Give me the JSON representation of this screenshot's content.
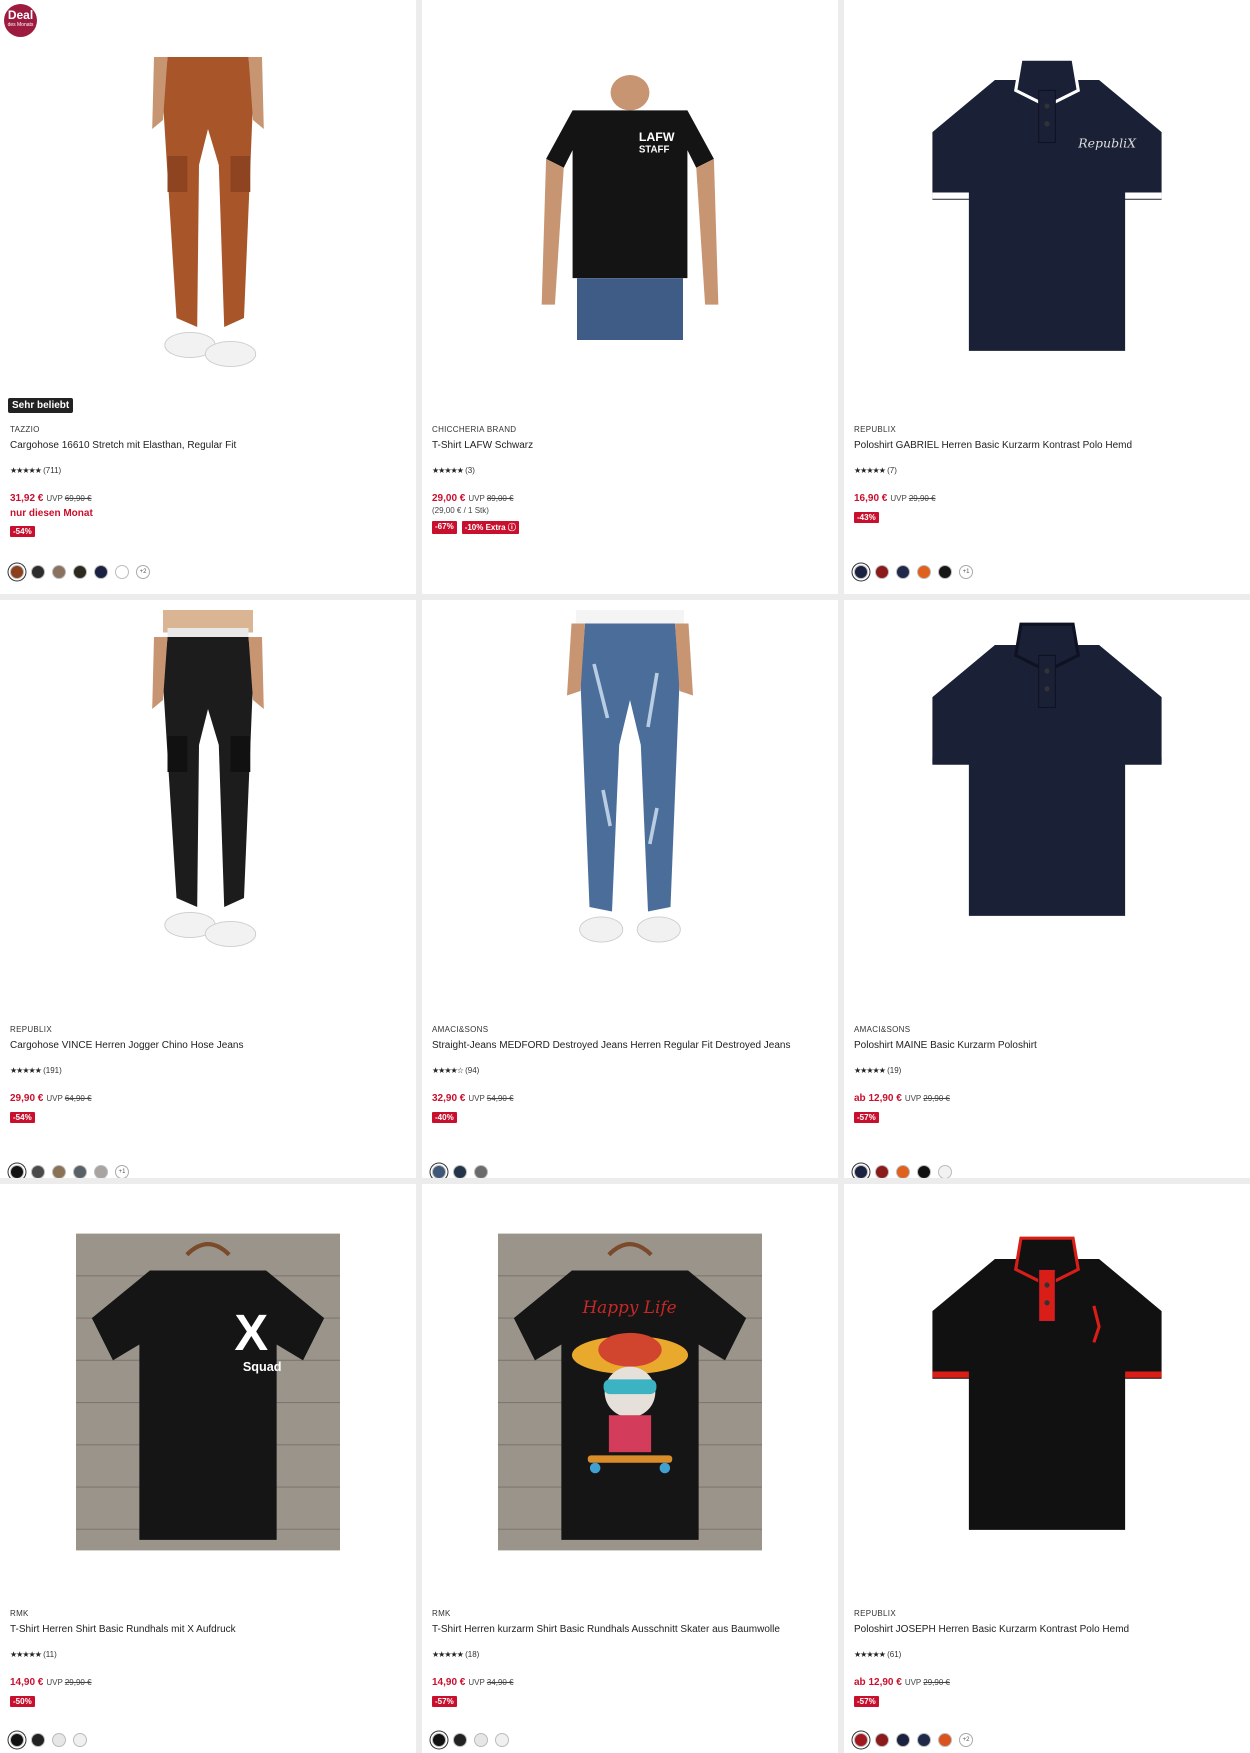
{
  "deal_badge": {
    "label": "Deal",
    "sub": "des Monats"
  },
  "products": [
    {
      "brand": "TAZZIO",
      "title": "Cargohose 16610 Stretch mit Elasthan, Regular Fit",
      "stars": "★★★★★",
      "reviews": "(711)",
      "price": "31,92 €",
      "uvp": "UVP",
      "old_price": "69,90 €",
      "month": "nur diesen Monat",
      "unit": "",
      "discounts": [
        "-54%"
      ],
      "swatches": [
        "#8b3f1c",
        "#2d2d2d",
        "#8a7260",
        "#2c2a1e",
        "#1b2140",
        "#ffffff"
      ],
      "more": "+2",
      "popular": "Sehr beliebt",
      "image": "pants-brown"
    },
    {
      "brand": "CHICCHERIA BRAND",
      "title": "T-Shirt LAFW Schwarz",
      "stars": "★★★★★",
      "reviews": "(3)",
      "price": "29,00 €",
      "uvp": "UVP",
      "old_price": "89,00 €",
      "month": "",
      "unit": "(29,00 € / 1 Stk)",
      "discounts": [
        "-67%",
        "-10% Extra ⓘ"
      ],
      "swatches": [],
      "more": "",
      "popular": "",
      "image": "tshirt-lafw"
    },
    {
      "brand": "REPUBLIX",
      "title": "Poloshirt GABRIEL Herren Basic Kurzarm Kontrast Polo Hemd",
      "stars": "★★★★★",
      "reviews": "(7)",
      "price": "16,90 €",
      "uvp": "UVP",
      "old_price": "29,90 €",
      "month": "",
      "unit": "",
      "discounts": [
        "-43%"
      ],
      "swatches": [
        "#1b2140",
        "#8b1a1a",
        "#1f2a4a",
        "#e0601e",
        "#161616"
      ],
      "more": "+1",
      "popular": "",
      "image": "polo-navy-stripe"
    },
    {
      "brand": "REPUBLIX",
      "title": "Cargohose VINCE Herren Jogger Chino Hose Jeans",
      "stars": "★★★★★",
      "reviews": "(191)",
      "price": "29,90 €",
      "uvp": "UVP",
      "old_price": "64,90 €",
      "month": "",
      "unit": "",
      "discounts": [
        "-54%"
      ],
      "swatches": [
        "#111111",
        "#4a4a4a",
        "#8a7256",
        "#5a6068",
        "#a8a4a2"
      ],
      "more": "+1",
      "popular": "",
      "image": "pants-black"
    },
    {
      "brand": "AMACI&SONS",
      "title": "Straight-Jeans MEDFORD Destroyed Jeans Herren Regular Fit Destroyed Jeans",
      "stars": "★★★★☆",
      "reviews": "(94)",
      "price": "32,90 €",
      "uvp": "UVP",
      "old_price": "54,90 €",
      "month": "",
      "unit": "",
      "discounts": [
        "-40%"
      ],
      "swatches": [
        "#3f5878",
        "#243449",
        "#6b6b6b"
      ],
      "more": "",
      "popular": "",
      "image": "jeans"
    },
    {
      "brand": "AMACI&SONS",
      "title": "Poloshirt MAINE Basic Kurzarm Poloshirt",
      "stars": "★★★★★",
      "reviews": "(19)",
      "price": "ab 12,90 €",
      "uvp": "UVP",
      "old_price": "29,90 €",
      "month": "",
      "unit": "",
      "discounts": [
        "-57%"
      ],
      "swatches": [
        "#1b2140",
        "#8b1a1a",
        "#e0601e",
        "#111111",
        "#f2f2f2"
      ],
      "more": "",
      "popular": "",
      "image": "polo-navy"
    },
    {
      "brand": "RMK",
      "title": "T-Shirt Herren Shirt Basic Rundhals mit X Aufdruck",
      "stars": "★★★★★",
      "reviews": "(11)",
      "price": "14,90 €",
      "uvp": "UVP",
      "old_price": "29,90 €",
      "month": "",
      "unit": "",
      "discounts": [
        "-50%"
      ],
      "swatches": [
        "#111111",
        "#222222",
        "#e6e6e6",
        "#f0f0f0"
      ],
      "more": "",
      "popular": "",
      "image": "tshirt-x"
    },
    {
      "brand": "RMK",
      "title": "T-Shirt Herren kurzarm Shirt Basic Rundhals Ausschnitt Skater aus Baumwolle",
      "stars": "★★★★★",
      "reviews": "(18)",
      "price": "14,90 €",
      "uvp": "UVP",
      "old_price": "34,90 €",
      "month": "",
      "unit": "",
      "discounts": [
        "-57%"
      ],
      "swatches": [
        "#111111",
        "#222222",
        "#e6e6e6",
        "#f0f0f0"
      ],
      "more": "",
      "popular": "",
      "image": "tshirt-skater"
    },
    {
      "brand": "REPUBLIX",
      "title": "Poloshirt JOSEPH Herren Basic Kurzarm Kontrast Polo Hemd",
      "stars": "★★★★★",
      "reviews": "(61)",
      "price": "ab 12,90 €",
      "uvp": "UVP",
      "old_price": "29,90 €",
      "month": "",
      "unit": "",
      "discounts": [
        "-57%"
      ],
      "swatches": [
        "#a01820",
        "#8b1a1a",
        "#1b2140",
        "#1f2a4a",
        "#d9541e"
      ],
      "more": "+2",
      "popular": "",
      "image": "polo-black-red"
    }
  ]
}
